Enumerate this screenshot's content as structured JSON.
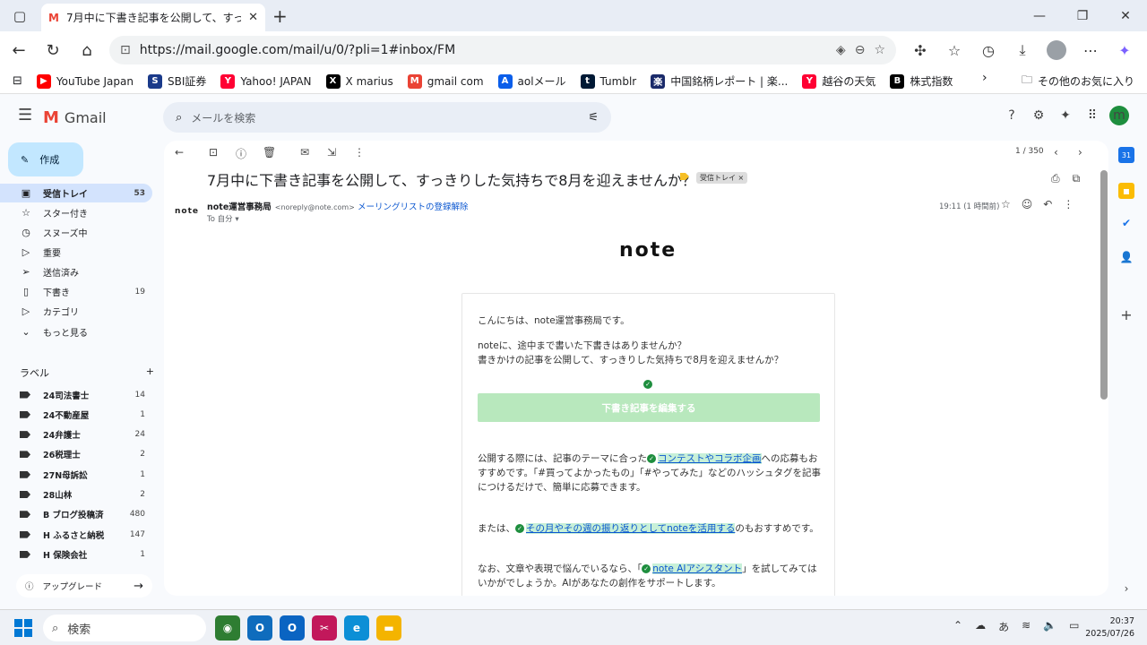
{
  "browser": {
    "tab_title": "7月中に下書き記事を公開して、すっき",
    "url": "https://mail.google.com/mail/u/0/?pli=1#inbox/FM",
    "bookmarks": [
      {
        "label": "YouTube Japan",
        "color": "#ff0000",
        "glyph": "▶"
      },
      {
        "label": "SBI証券",
        "color": "#1a3a8a",
        "glyph": "S"
      },
      {
        "label": "Yahoo! JAPAN",
        "color": "#ff0033",
        "glyph": "Y"
      },
      {
        "label": "X marius",
        "color": "#000000",
        "glyph": "X"
      },
      {
        "label": "gmail com",
        "color": "#ea4335",
        "glyph": "M"
      },
      {
        "label": "aolメール",
        "color": "#0a5eea",
        "glyph": "A"
      },
      {
        "label": "Tumblr",
        "color": "#001935",
        "glyph": "t"
      },
      {
        "label": "中国銘柄レポート | 楽...",
        "color": "#1a2a6a",
        "glyph": "楽"
      },
      {
        "label": "越谷の天気",
        "color": "#ff0033",
        "glyph": "Y"
      },
      {
        "label": "株式指数",
        "color": "#000000",
        "glyph": "B"
      }
    ],
    "other_bookmarks": "その他のお気に入り"
  },
  "gmail": {
    "app_name": "Gmail",
    "search_placeholder": "メールを検索",
    "profile_initial": "m",
    "compose_label": "作成",
    "nav": [
      {
        "label": "受信トレイ",
        "count": "53",
        "icon": "▣"
      },
      {
        "label": "スター付き",
        "count": "",
        "icon": "☆"
      },
      {
        "label": "スヌーズ中",
        "count": "",
        "icon": "◷"
      },
      {
        "label": "重要",
        "count": "",
        "icon": "▷"
      },
      {
        "label": "送信済み",
        "count": "",
        "icon": "➢"
      },
      {
        "label": "下書き",
        "count": "19",
        "icon": "▯"
      },
      {
        "label": "カテゴリ",
        "count": "",
        "icon": "▷"
      },
      {
        "label": "もっと見る",
        "count": "",
        "icon": "⌄"
      }
    ],
    "labels_heading": "ラベル",
    "labels": [
      {
        "label": "24司法書士",
        "count": "14"
      },
      {
        "label": "24不動産屋",
        "count": "1"
      },
      {
        "label": "24弁護士",
        "count": "24"
      },
      {
        "label": "26税理士",
        "count": "2"
      },
      {
        "label": "27N母訴訟",
        "count": "1"
      },
      {
        "label": "28山林",
        "count": "2"
      },
      {
        "label": "B ブログ投稿済",
        "count": "480"
      },
      {
        "label": "H ふるさと納税",
        "count": "147"
      },
      {
        "label": "H 保険会社",
        "count": "1"
      }
    ],
    "upgrade_label": "アップグレード",
    "pager": "1 / 350"
  },
  "email": {
    "subject": "7月中に下書き記事を公開して、すっきりした気持ちで8月を迎えませんか？",
    "chip": "受信トレイ ×",
    "sender_name": "note運営事務局",
    "sender_email": "<noreply@note.com>",
    "unsubscribe": "メーリングリストの登録解除",
    "to": "To 自分 ▾",
    "time": "19:11 (1 時間前)",
    "logo_text": "note",
    "sender_avatar_text": "note",
    "greeting": "こんにちは、note運営事務局です。",
    "para1_line1": "noteに、途中まで書いた下書きはありませんか？",
    "para1_line2": "書きかけの記事を公開して、すっきりした気持ちで8月を迎えませんか？",
    "button": "下書き記事を編集する",
    "para2_pre": "公開する際には、記事のテーマに合った",
    "para2_link": "コンテストやコラボ企画",
    "para2_post": "への応募もおすすめです。「#買ってよかったもの」「#やってみた」などのハッシュタグを記事につけるだけで、簡単に応募できます。",
    "para3_pre": "または、",
    "para3_link": "その月やその週の振り返りとしてnoteを活用する",
    "para3_post": "のもおすすめです。",
    "para4_pre": "なお、文章や表現で悩んでいるなら、「",
    "para4_link": "note AIアシスタント",
    "para4_post": "」を試してみてはいかがでしょうか。AIがあなたの創作をサポートします。"
  },
  "taskbar": {
    "search_placeholder": "検索",
    "time": "20:37",
    "date": "2025/07/26",
    "ime": "あ"
  }
}
